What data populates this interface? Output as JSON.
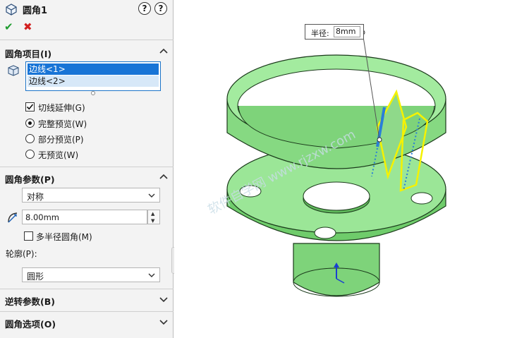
{
  "panel": {
    "title": "圆角1",
    "help_label": "?",
    "help2_label": "?",
    "ok_label": "✔",
    "cancel_label": "✖"
  },
  "items_section": {
    "header": "圆角项目(I)",
    "list": [
      "边线<1>",
      "边线<2>"
    ],
    "tangent_label": "切线延伸(G)",
    "tangent_checked": true,
    "preview_options": [
      {
        "label": "完整预览(W)",
        "selected": true
      },
      {
        "label": "部分预览(P)",
        "selected": false
      },
      {
        "label": "无预览(W)",
        "selected": false
      }
    ]
  },
  "params_section": {
    "header": "圆角参数(P)",
    "type_value": "对称",
    "radius_value": "8.00mm",
    "multi_radius_label": "多半径圆角(M)",
    "multi_radius_checked": false,
    "profile_label": "轮廓(P):",
    "profile_value": "圆形"
  },
  "reverse_section": {
    "header": "逆转参数(B)"
  },
  "options_section": {
    "header": "圆角选项(O)"
  },
  "viewport": {
    "callout_key": "半径:",
    "callout_value": "8mm",
    "watermark": "软件自学网 www.rjzxw.com"
  },
  "colors": {
    "part_green": "#8fe08a",
    "selection_yellow": "#f5f200",
    "selection_blue": "#2a7ed8"
  }
}
